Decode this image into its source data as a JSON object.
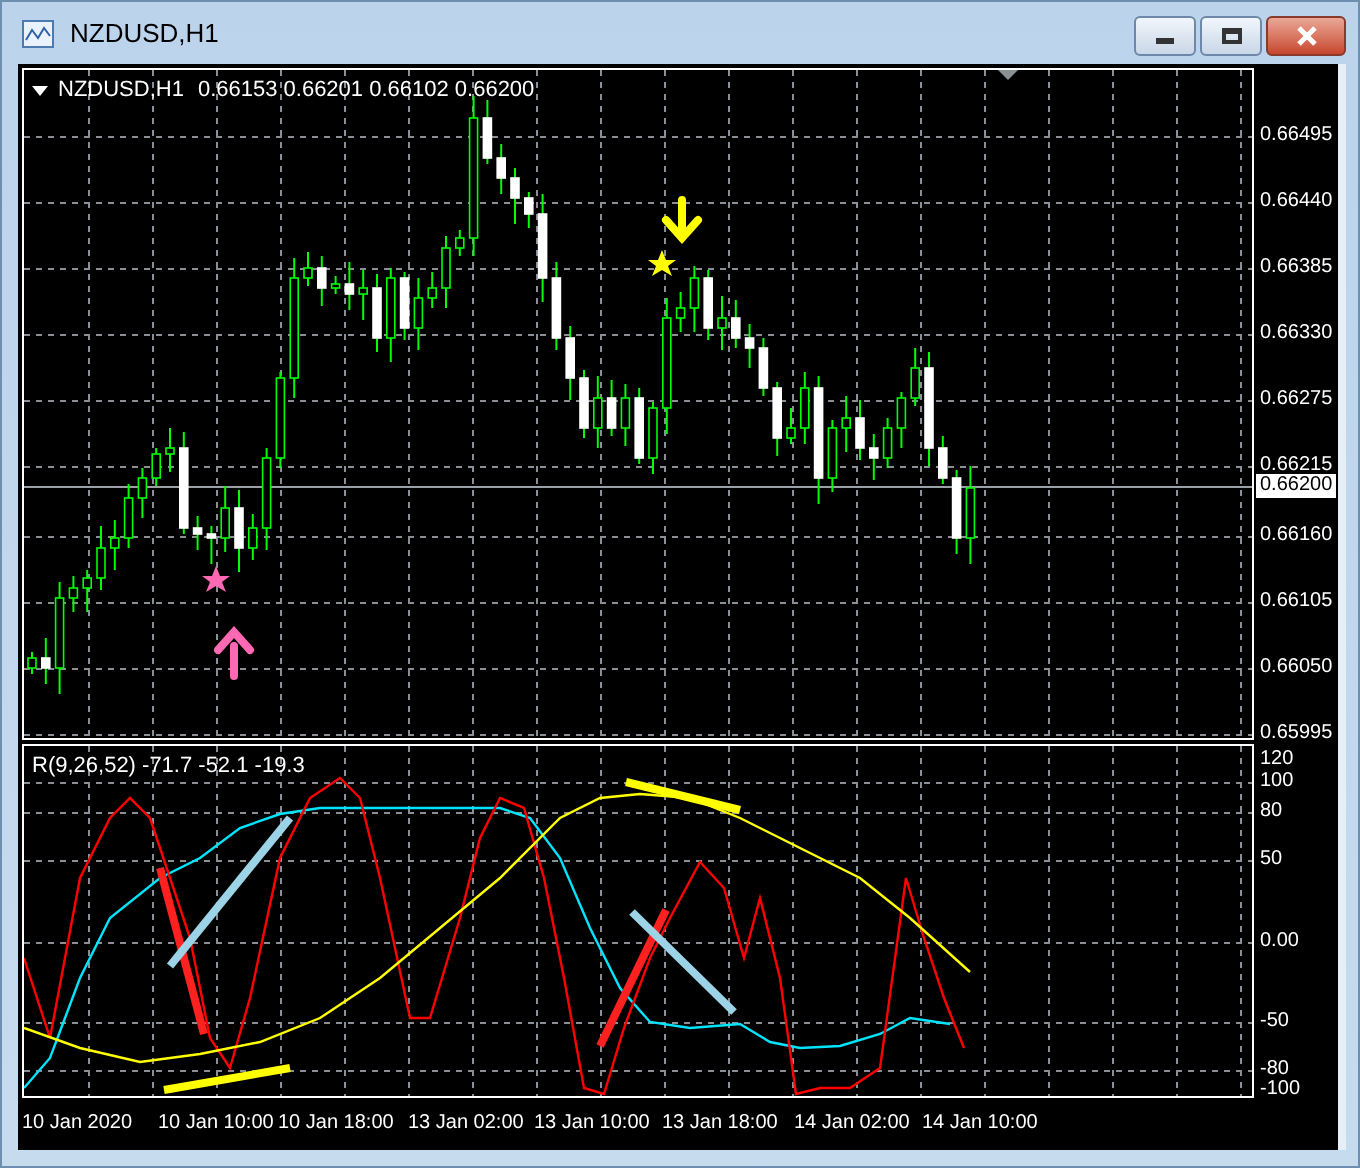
{
  "window": {
    "title": "NZDUSD,H1"
  },
  "chart": {
    "symbol": "NZDUSD,H1",
    "quote": "0.66153 0.66201 0.66102 0.66200"
  },
  "price_axis": {
    "labels": [
      "0.66495",
      "0.66440",
      "0.66385",
      "0.66330",
      "0.66275",
      "0.66215",
      "0.66160",
      "0.66105",
      "0.66050",
      "0.65995"
    ],
    "current_price": "0.66200"
  },
  "indicator": {
    "label": "R(9,26,52) -71.7 -52.1 -19.3"
  },
  "indicator_axis": {
    "labels": [
      "120",
      "100",
      "80",
      "50",
      "0.00",
      "-50",
      "-80",
      "-100"
    ]
  },
  "time_axis": {
    "labels": [
      "10 Jan 2020",
      "10 Jan 10:00",
      "10 Jan 18:00",
      "13 Jan 02:00",
      "13 Jan 10:00",
      "13 Jan 18:00",
      "14 Jan 02:00",
      "14 Jan 10:00"
    ]
  }
}
